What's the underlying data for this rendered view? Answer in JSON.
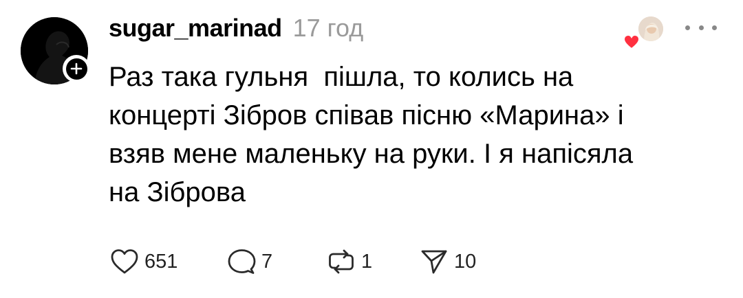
{
  "post": {
    "username": "sugar_marinad",
    "timestamp": "17 год",
    "lines": [
      "Раз така гульня  пішла, то колись на",
      "концерті Зібров співав пісню «Марина» і",
      "взяв мене маленьку на руки. І я напісяла",
      "на Зіброва"
    ]
  },
  "actions": {
    "likes": "651",
    "replies": "7",
    "reposts": "1",
    "shares": "10"
  },
  "icons": {
    "avatar": "profile-avatar",
    "follow": "plus-icon",
    "liked_by": "liked-by-avatar",
    "heart_badge": "heart-icon",
    "more": "more-icon",
    "like": "heart-outline-icon",
    "reply": "comment-icon",
    "repost": "repost-icon",
    "share": "send-icon"
  },
  "colors": {
    "text": "#000000",
    "muted": "#9a9a9a",
    "heart": "#ff3040"
  }
}
